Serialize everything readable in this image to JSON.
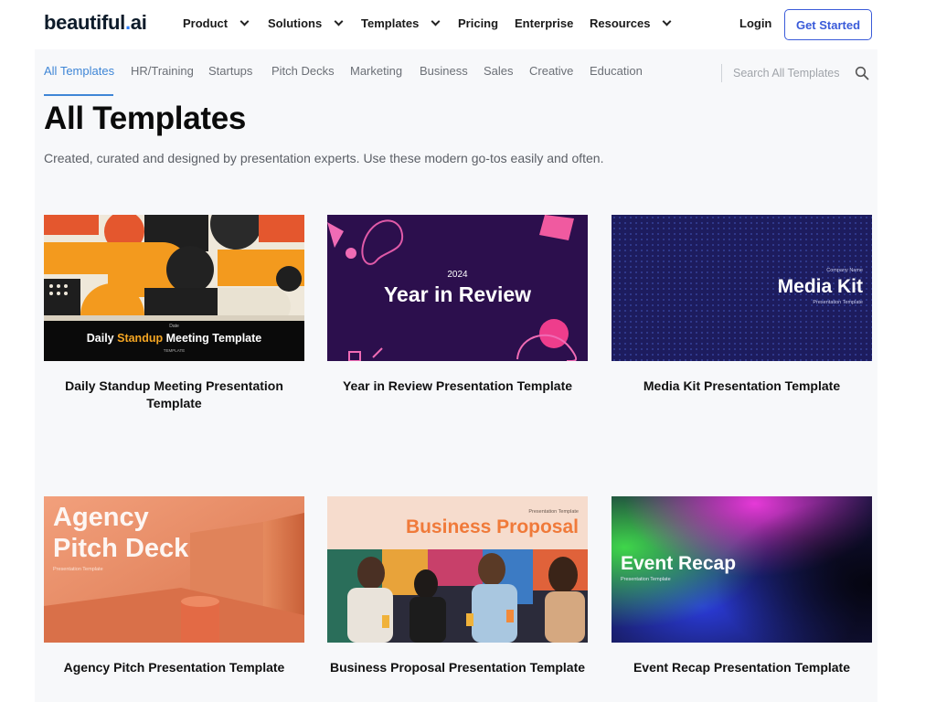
{
  "brand": {
    "logo_main": "beautiful",
    "logo_dot": ".",
    "logo_ai": "ai"
  },
  "nav": {
    "items": [
      {
        "label": "Product",
        "has_dropdown": true
      },
      {
        "label": "Solutions",
        "has_dropdown": true
      },
      {
        "label": "Templates",
        "has_dropdown": true
      },
      {
        "label": "Pricing",
        "has_dropdown": false
      },
      {
        "label": "Enterprise",
        "has_dropdown": false
      },
      {
        "label": "Resources",
        "has_dropdown": true
      }
    ],
    "login": "Login",
    "get_started": "Get Started"
  },
  "tabs": {
    "items": [
      {
        "label": "All Templates",
        "active": true
      },
      {
        "label": "HR/Training",
        "active": false
      },
      {
        "label": "Startups",
        "active": false
      },
      {
        "label": "Pitch Decks",
        "active": false
      },
      {
        "label": "Marketing",
        "active": false
      },
      {
        "label": "Business",
        "active": false
      },
      {
        "label": "Sales",
        "active": false
      },
      {
        "label": "Creative",
        "active": false
      },
      {
        "label": "Education",
        "active": false
      }
    ],
    "search_placeholder": "Search All Templates"
  },
  "header": {
    "title": "All Templates",
    "subtitle": "Created, curated and designed by presentation experts. Use these modern go-tos easily and often."
  },
  "cards": [
    {
      "title": "Daily Standup Meeting Presentation Template",
      "thumb": {
        "kicker": "Date",
        "text_pre": "Daily ",
        "text_highlight": "Standup",
        "text_post": " Meeting Template",
        "footer": "TEMPLATE"
      }
    },
    {
      "title": "Year in Review Presentation Template",
      "thumb": {
        "year": "2024",
        "heading": "Year in Review"
      }
    },
    {
      "title": "Media Kit Presentation Template",
      "thumb": {
        "kicker": "Company Name",
        "heading": "Media Kit",
        "sub": "Presentation Template"
      }
    },
    {
      "title": "Agency Pitch Presentation Template",
      "thumb": {
        "heading_line1": "Agency",
        "heading_line2": "Pitch Deck",
        "sub": "Presentation Template"
      }
    },
    {
      "title": "Business Proposal Presentation Template",
      "thumb": {
        "kicker": "Presentation Template",
        "heading": "Business Proposal"
      }
    },
    {
      "title": "Event Recap Presentation Template",
      "thumb": {
        "heading": "Event Recap",
        "sub": "Presentation Template"
      }
    }
  ],
  "colors": {
    "accent_blue": "#3f86d6",
    "button_blue": "#3a5bd9",
    "year_review_bg": "#2c0f4d",
    "media_kit_bg": "#1d1c5e",
    "business_proposal_heading": "#f07a3a",
    "standup_highlight": "#f5a623"
  }
}
